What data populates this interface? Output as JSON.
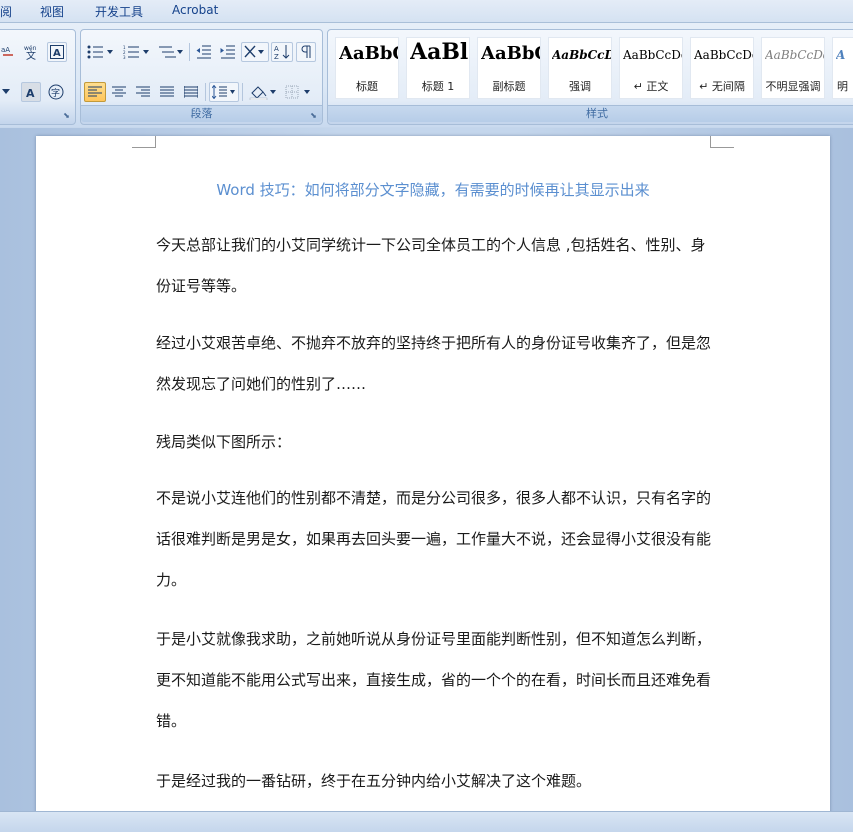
{
  "menu": {
    "tabs": [
      {
        "label": "阅"
      },
      {
        "label": "视图"
      },
      {
        "label": "开发工具"
      },
      {
        "label": "Acrobat"
      }
    ]
  },
  "ribbon": {
    "font_group_buttons": [
      "abc",
      "wén",
      "A",
      "A",
      "字"
    ],
    "paragraph_group": {
      "label": "段落"
    },
    "styles_group": {
      "label": "样式",
      "styles": [
        {
          "sample": "AaBbC",
          "name": "标题"
        },
        {
          "sample": "AaBl",
          "name": "标题 1"
        },
        {
          "sample": "AaBbC",
          "name": "副标题"
        },
        {
          "sample": "AaBbCcDd",
          "name": "强调"
        },
        {
          "sample": "AaBbCcDd",
          "name": "↵ 正文"
        },
        {
          "sample": "AaBbCcDd",
          "name": "↵ 无间隔"
        },
        {
          "sample": "AaBbCcDd",
          "name": "不明显强调"
        },
        {
          "sample": "A",
          "name": "明"
        }
      ]
    }
  },
  "document": {
    "title": "Word 技巧：如何将部分文字隐藏，有需要的时候再让其显示出来",
    "paragraphs": [
      "今天总部让我们的小艾同学统计一下公司全体员工的个人信息 ,包括姓名、性别、身份证号等等。",
      "经过小艾艰苦卓绝、不抛弃不放弃的坚持终于把所有人的身份证号收集齐了，但是忽然发现忘了问她们的性别了……",
      "残局类似下图所示：",
      "不是说小艾连他们的性别都不清楚，而是分公司很多，很多人都不认识，只有名字的话很难判断是男是女，如果再去回头要一遍，工作量大不说，还会显得小艾很没有能力。",
      "于是小艾就像我求助，之前她听说从身份证号里面能判断性别，但不知道怎么判断，更不知道能不能用公式写出来，直接生成，省的一个个的在看，时间长而且还难免看错。",
      "于是经过我的一番钻研，终于在五分钟内给小艾解决了这个难题。"
    ]
  },
  "colors": {
    "title_blue": "#5b8fd0",
    "ribbon_label": "#3e6aa1",
    "active_button": "#ffc55a"
  }
}
